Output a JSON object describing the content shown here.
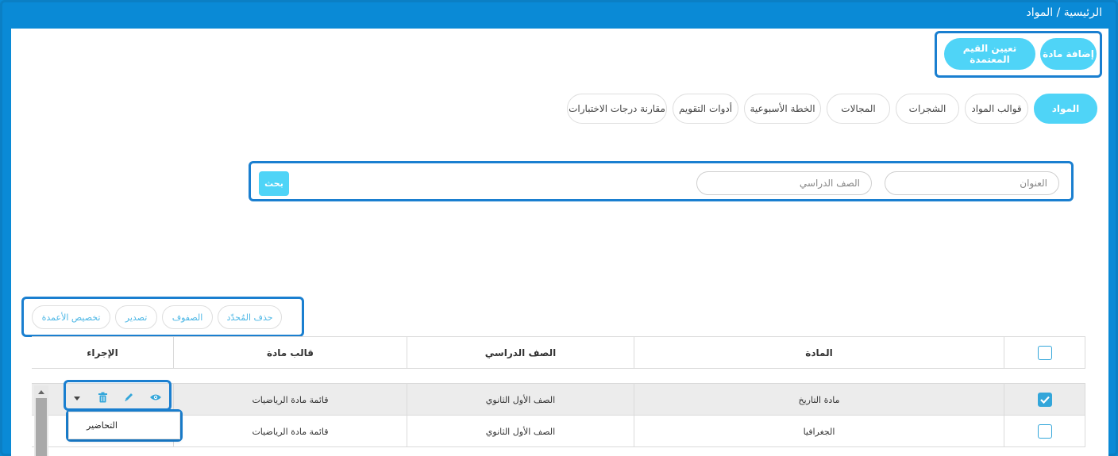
{
  "breadcrumb": "الرئيسية / المواد",
  "header_buttons": {
    "add_subject": "إضافة مادة",
    "assign_values": "تعيين القيم المعتمدة"
  },
  "tabs": [
    {
      "label": "المواد",
      "active": true
    },
    {
      "label": "قوالب المواد",
      "active": false
    },
    {
      "label": "الشجرات",
      "active": false
    },
    {
      "label": "المجالات",
      "active": false
    },
    {
      "label": "الخطة الأسبوعية",
      "active": false
    },
    {
      "label": "أدوات التقويم",
      "active": false
    },
    {
      "label": "مقارنة درجات الاختبارات",
      "active": false
    }
  ],
  "search": {
    "title_placeholder": "العنوان",
    "grade_placeholder": "الصف الدراسي",
    "button": "بحث"
  },
  "toolbar": {
    "delete_selected": "حذف المُحدّد",
    "rows": "الصفوف",
    "export": "تصدير",
    "customize_columns": "تخصيص الأعمدة"
  },
  "table": {
    "headers": {
      "subject": "المادة",
      "grade": "الصف الدراسي",
      "template": "قالب مادة",
      "action": "الإجراء"
    },
    "rows": [
      {
        "subject": "مادة التاريخ",
        "grade": "الصف الأول الثانوي",
        "template": "قائمة مادة الرياضيات",
        "checked": true
      },
      {
        "subject": "الجغرافيا",
        "grade": "الصف الأول الثانوي",
        "template": "قائمة مادة الرياضيات",
        "checked": false
      }
    ]
  },
  "dropdown": {
    "item": "التحاضير"
  },
  "icons": [
    "eye-icon",
    "pencil-icon",
    "trash-icon",
    "caret-down-icon",
    "scroll-up-icon",
    "check-icon"
  ],
  "colors": {
    "frame_blue": "#0a8ad6",
    "accent_cyan": "#4fd4f7",
    "highlight_border": "#1a7fd0",
    "checkbox_blue": "#33a6da"
  }
}
